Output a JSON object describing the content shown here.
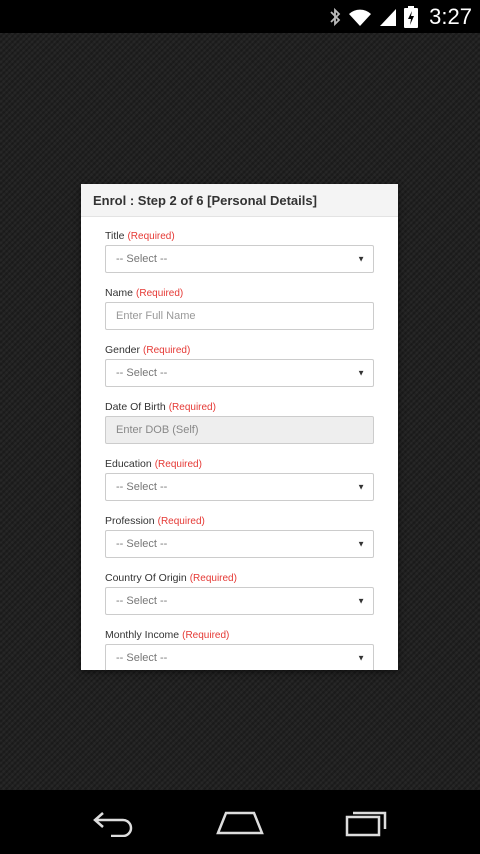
{
  "status_bar": {
    "time": "3:27",
    "icons": [
      "bluetooth-icon",
      "wifi-icon",
      "signal-icon",
      "battery-charging-icon"
    ]
  },
  "dialog": {
    "title": "Enrol : Step 2 of 6 [Personal Details]",
    "required_text": "(Required)",
    "fields": [
      {
        "label": "Title",
        "type": "select",
        "value": "-- Select --"
      },
      {
        "label": "Name",
        "type": "text",
        "placeholder": "Enter Full Name"
      },
      {
        "label": "Gender",
        "type": "select",
        "value": "-- Select --"
      },
      {
        "label": "Date Of Birth",
        "type": "text-disabled",
        "placeholder": "Enter DOB (Self)"
      },
      {
        "label": "Education",
        "type": "select",
        "value": "-- Select --"
      },
      {
        "label": "Profession",
        "type": "select",
        "value": "-- Select --"
      },
      {
        "label": "Country Of Origin",
        "type": "select",
        "value": "-- Select --"
      },
      {
        "label": "Monthly Income",
        "type": "select",
        "value": "-- Select --"
      }
    ]
  },
  "nav_bar": {
    "buttons": [
      "back-icon",
      "home-icon",
      "recents-icon"
    ]
  },
  "colors": {
    "required": "#e53935",
    "header_bg": "#f4f4f4"
  }
}
